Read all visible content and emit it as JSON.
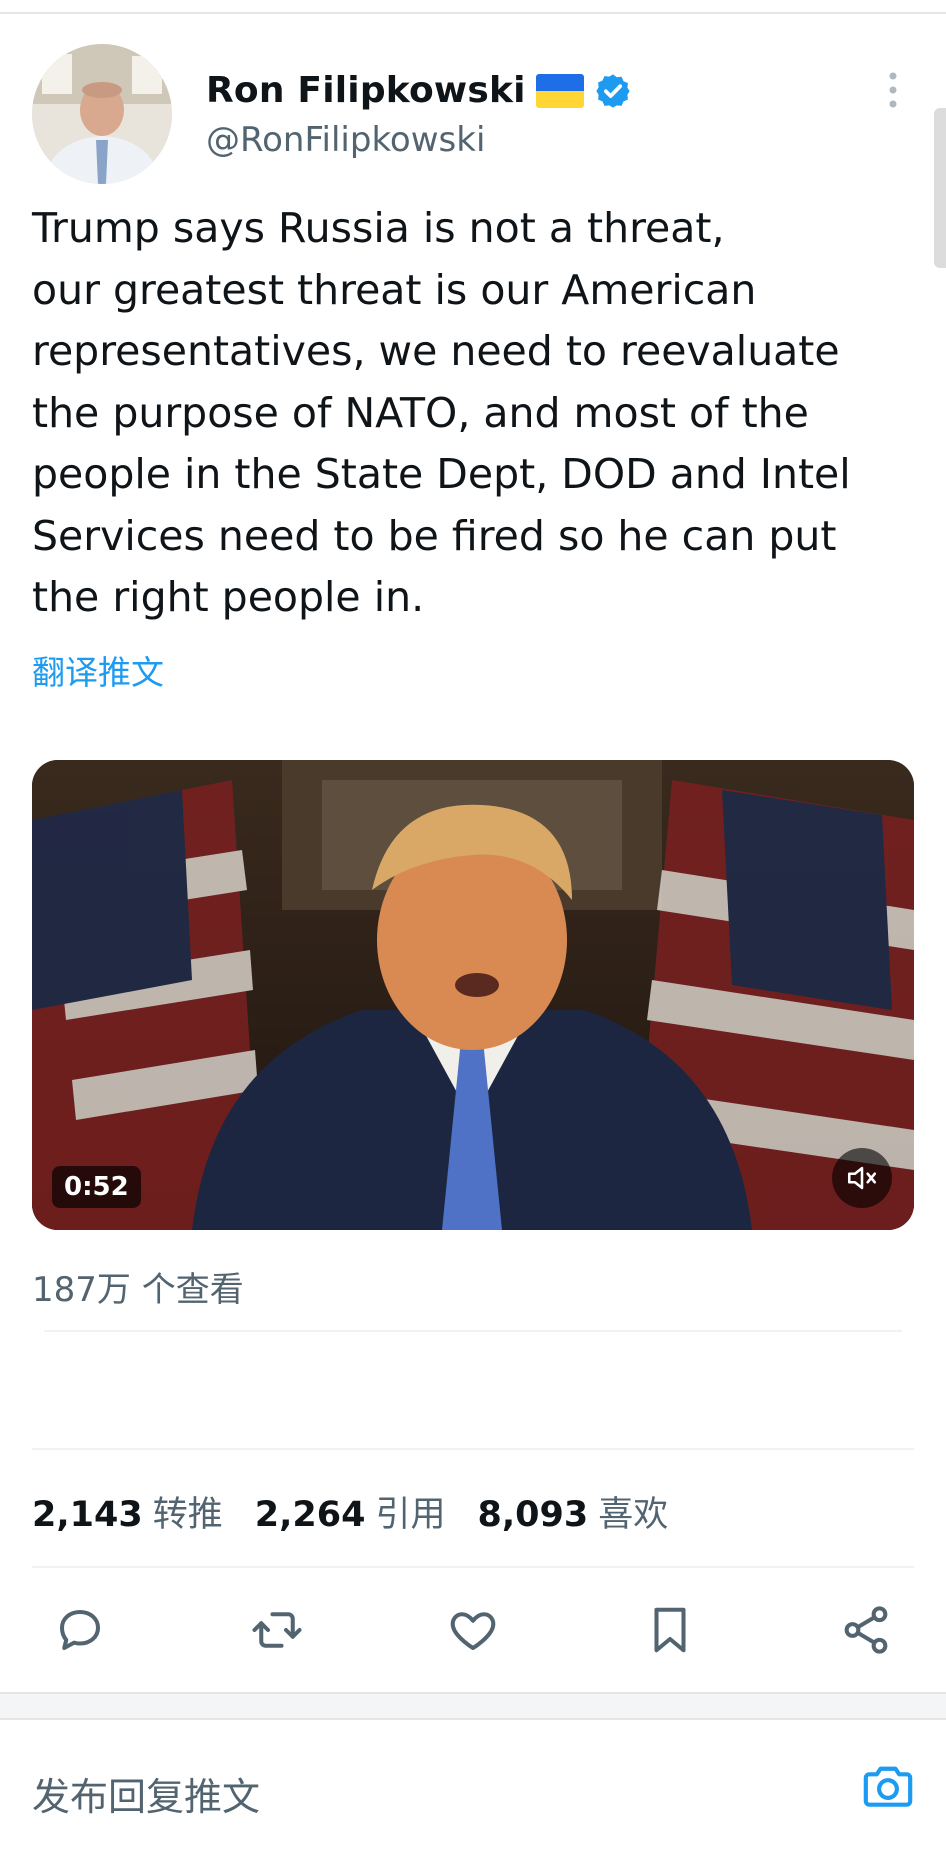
{
  "tweet": {
    "author_name": "Ron Filipkowski",
    "author_handle": "@RonFilipkowski",
    "text": "Trump says Russia is not a threat,\nour greatest threat is our American\nrepresentatives, we need to reevaluate\nthe purpose of NATO, and most of the\npeople in the State Dept, DOD and Intel\nServices need to be fired so he can put\nthe right people in.",
    "translate_label": "翻译推文",
    "video_duration": "0:52",
    "views": "187万 个查看"
  },
  "stats": {
    "retweets_count": "2,143",
    "retweets_label": "转推",
    "quotes_count": "2,264",
    "quotes_label": "引用",
    "likes_count": "8,093",
    "likes_label": "喜欢"
  },
  "actions": [
    "reply-icon",
    "retweet-icon",
    "like-icon",
    "bookmark-icon",
    "share-icon"
  ],
  "reply": {
    "placeholder": "发布回复推文"
  },
  "colors": {
    "accent": "#1d9bf0",
    "text_primary": "#0f1419",
    "text_secondary": "#536471",
    "flag_blue": "#1e6ee8",
    "flag_yellow": "#ffd633"
  }
}
